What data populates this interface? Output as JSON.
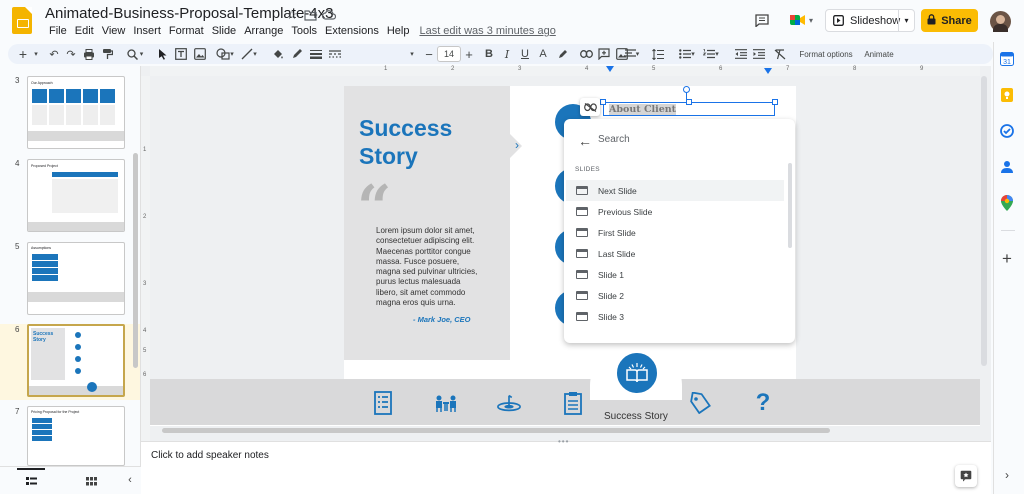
{
  "header": {
    "doc_title": "Animated-Business-Proposal-Template-4x3",
    "menus": [
      "File",
      "Edit",
      "View",
      "Insert",
      "Format",
      "Slide",
      "Arrange",
      "Tools",
      "Extensions",
      "Help"
    ],
    "last_edit": "Last edit was 3 minutes ago",
    "slideshow_label": "Slideshow",
    "share_label": "Share"
  },
  "toolbar": {
    "font_size": "14",
    "format_options": "Format options",
    "animate": "Animate"
  },
  "filmstrip": {
    "numbers": [
      "3",
      "4",
      "5",
      "6",
      "7"
    ],
    "selected": "6",
    "thumb_titles": [
      "Our Approach",
      "Proposed Project",
      "Assumptions",
      "Success Story",
      "Pricing Proposal for the Project"
    ]
  },
  "ruler": {
    "top_ticks": [
      "1",
      "2",
      "3",
      "4",
      "5",
      "6",
      "7",
      "8",
      "9"
    ],
    "left_ticks": [
      "1",
      "2",
      "3",
      "4",
      "5",
      "6"
    ]
  },
  "slide": {
    "title_line1": "Success",
    "title_line2": "Story",
    "quote_mark": "“",
    "body": "Lorem ipsum dolor sit amet, consectetuer adipiscing elit. Maecenas porttitor congue massa. Fusce posuere, magna sed pulvinar ultricies, purus lectus malesuada libero, sit amet commodo magna eros quis urna.",
    "author": "- Mark Joe, CEO",
    "about_client": "About Client",
    "nav_label": "Success Story"
  },
  "dropdown": {
    "search_placeholder": "Search",
    "section_header": "SLIDES",
    "items": [
      "Next Slide",
      "Previous Slide",
      "First Slide",
      "Last Slide",
      "Slide 1",
      "Slide 2",
      "Slide 3"
    ],
    "highlighted": "Next Slide"
  },
  "notes": {
    "placeholder": "Click to add speaker notes"
  },
  "colors": {
    "accent": "#1b75bb",
    "share": "#fbbc04",
    "panel": "#e2e2e3"
  }
}
